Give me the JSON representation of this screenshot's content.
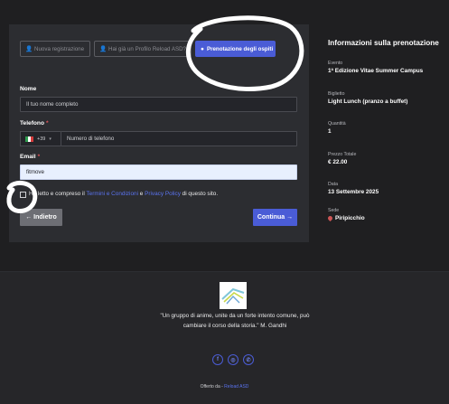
{
  "steps": [
    {
      "label": "Nuova registrazione",
      "icon": "user-plus-icon"
    },
    {
      "label": "Hai già un Profilo Reload ASD?",
      "icon": "user-check-icon"
    },
    {
      "label": "Prenotazione degli ospiti",
      "icon": "user-icon"
    }
  ],
  "form": {
    "name_label": "Nome",
    "name_value": "Il tuo nome completo",
    "phone_label": "Telefono",
    "phone_prefix": "+39",
    "phone_placeholder": "Numero di telefono",
    "email_label": "Email",
    "email_value": "fitmove",
    "required_mark": "*",
    "consent_prefix": "Ho letto e compreso il ",
    "consent_terms": "Termini e Condizioni",
    "consent_and": " e ",
    "consent_privacy": "Privacy Policy",
    "consent_suffix": " di questo sito.",
    "back_label": "← Indietro",
    "next_label": "Continua →"
  },
  "summary": {
    "title": "Informazioni sulla prenotazione",
    "event_key": "Evento",
    "event_val": "1ª Edizione Vitae Summer Campus",
    "ticket_key": "Biglietto",
    "ticket_val": "Light Lunch (pranzo a buffet)",
    "qty_key": "Quantità",
    "qty_val": "1",
    "price_key": "Prezzo Totale",
    "price_val": "€ 22.00",
    "date_key": "Data",
    "date_val": "13 Settembre 2025",
    "venue_key": "Sede",
    "venue_val": "Piripicchio"
  },
  "footer": {
    "quote_line1": "\"Un gruppo di anime, unite da un forte intento comune, può",
    "quote_line2": "cambiare il corso della storia.\" M. Gandhi",
    "socials": [
      "f",
      "◎",
      "✆"
    ],
    "credits_prefix": "Offerto da - ",
    "credits_link": "Reload ASD"
  },
  "colors": {
    "accent": "#4a5cd6",
    "background": "#1f1f21",
    "card": "#2c2d31"
  }
}
